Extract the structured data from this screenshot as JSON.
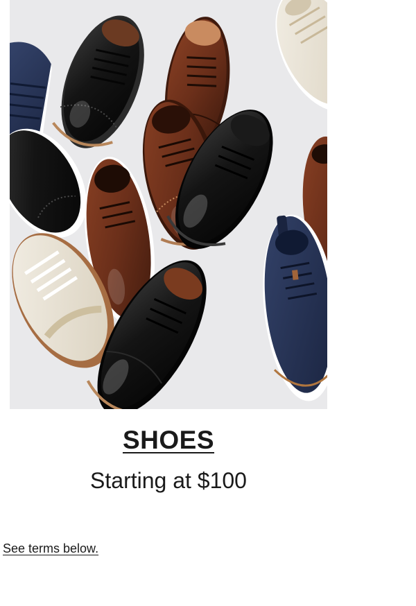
{
  "promo": {
    "image_subject": "shoes-assortment",
    "title": "SHOES",
    "subtitle": "Starting at $100",
    "terms_link": "See terms below."
  },
  "colors": {
    "background": "#ffffff",
    "image_backdrop": "#eaeaec",
    "text": "#1a1a1a",
    "brown_leather": "#6b2f1a",
    "black_leather": "#121212",
    "navy_knit": "#26324f",
    "cream_knit": "#e9e3d6"
  }
}
